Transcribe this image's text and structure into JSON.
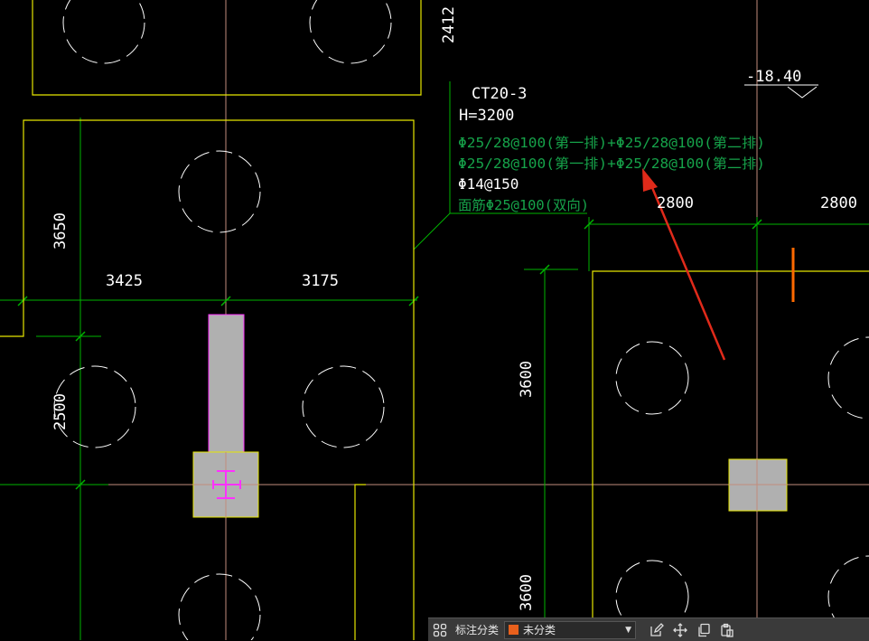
{
  "drawing": {
    "block_title": "CT20-3",
    "height_spec": "H=3200",
    "rebar_line1": "Φ25/28@100(第一排)+Φ25/28@100(第二排)",
    "rebar_line2": "Φ25/28@100(第一排)+Φ25/28@100(第二排)",
    "stirrup": "Φ14@150",
    "top_rebar": "面筋Φ25@100(双向)",
    "elevation": "-18.40",
    "dims": {
      "d2412": "2412",
      "d3650": "3650",
      "d3425": "3425",
      "d3175": "3175",
      "d2500": "2500",
      "d2800a": "2800",
      "d2800b": "2800",
      "d3600a": "3600",
      "d3600b": "3600"
    }
  },
  "toolbar": {
    "label": "标注分类",
    "selected": "未分类",
    "icons": [
      "grid-icon",
      "edit-icon",
      "move-icon",
      "copy-icon",
      "paste-icon"
    ]
  },
  "colors": {
    "outline": "#e6e600",
    "axis": "#c28c7c",
    "dimension": "#00b400",
    "white_text": "#ffffff",
    "green_text": "#16a34a",
    "arrow": "#e02a1a",
    "column_fill": "#b0b0b0",
    "steel": "#ff30ff",
    "orange_mark": "#ff6a00"
  }
}
